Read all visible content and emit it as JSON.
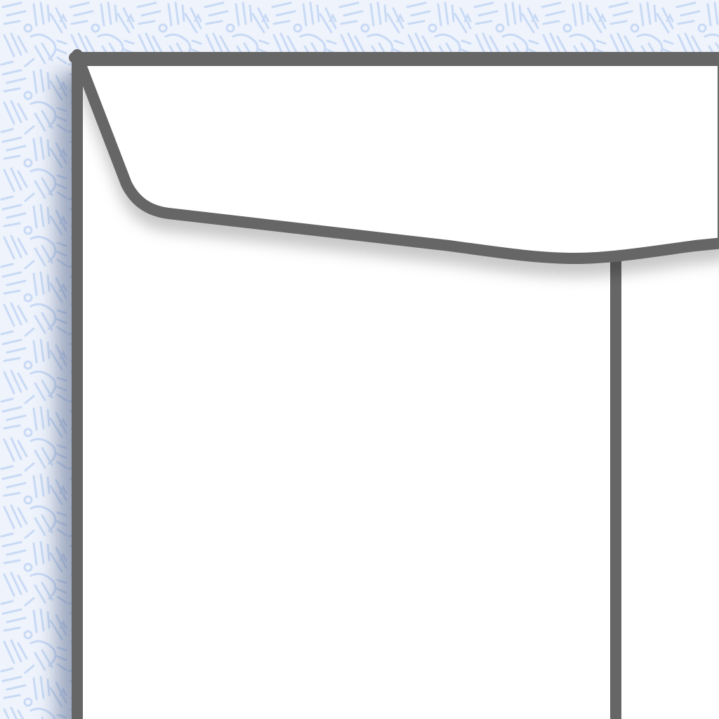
{
  "scene": {
    "subject": "envelope-back-closeup",
    "colors": {
      "background": "#ffffff",
      "pattern_stroke": "#c9daf5",
      "pattern_fill": "#eef3fc",
      "envelope_fill": "#ffffff",
      "outline": "#666666",
      "shadow": "#5a6a8c"
    },
    "icons": {
      "pattern": "doodle-pattern-icon",
      "envelope": "envelope-icon",
      "flap": "envelope-flap-icon",
      "seam": "envelope-seam-icon"
    }
  }
}
